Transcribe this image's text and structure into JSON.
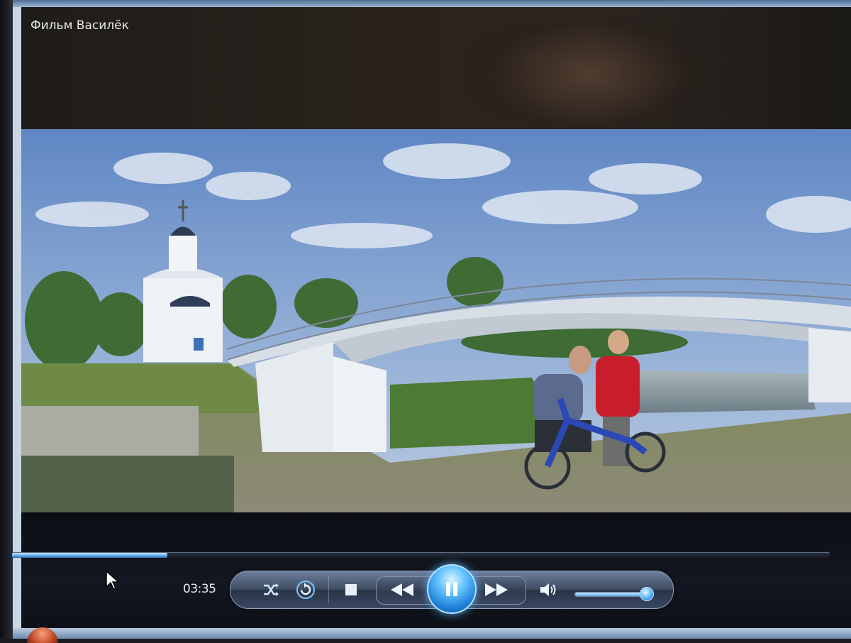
{
  "window": {
    "title": "Фильм Василёк"
  },
  "player": {
    "elapsed_time": "03:35",
    "progress_fraction": 0.19,
    "volume_fraction": 0.97,
    "state": "playing"
  },
  "controls": {
    "icons": {
      "shuffle": "shuffle-icon",
      "repeat": "repeat-icon",
      "stop": "stop-icon",
      "previous": "previous-icon",
      "play_pause": "pause-icon",
      "next": "next-icon",
      "volume": "volume-icon"
    }
  },
  "colors": {
    "accent": "#5fc1ff",
    "seek_fill": "#5aa6e6",
    "pill": "#3f4d63"
  }
}
